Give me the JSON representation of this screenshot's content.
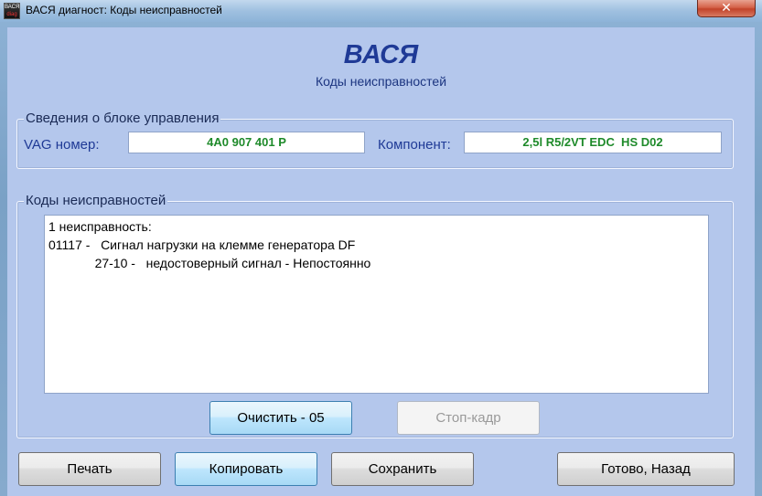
{
  "window": {
    "title": "ВАСЯ диагност: Коды неисправностей",
    "icon_text_top": "ВАСЯ",
    "icon_text_bottom": "diag",
    "close_label": "✕"
  },
  "header": {
    "title": "ВАСЯ",
    "subtitle": "Коды неисправностей"
  },
  "control_unit": {
    "group_label": "Сведения о блоке управления",
    "vag_label": "VAG номер:",
    "vag_value": "4A0 907 401 P",
    "component_label": "Компонент:",
    "component_value": "2,5l R5/2VT EDC  HS D02"
  },
  "faults": {
    "group_label": "Коды неисправностей",
    "lines": [
      "1 неисправность:",
      "01117 -   Сигнал нагрузки на клемме генератора DF",
      "             27-10 -   недостоверный сигнал - Непостоянно"
    ]
  },
  "buttons": {
    "clear": "Очистить - 05",
    "freeze_frame": "Стоп-кадр",
    "print": "Печать",
    "copy": "Копировать",
    "save": "Сохранить",
    "done": "Готово, Назад"
  },
  "colors": {
    "client_bg": "#b4c7ec",
    "title_blue": "#1f3a96",
    "value_green": "#1e8a2a"
  }
}
